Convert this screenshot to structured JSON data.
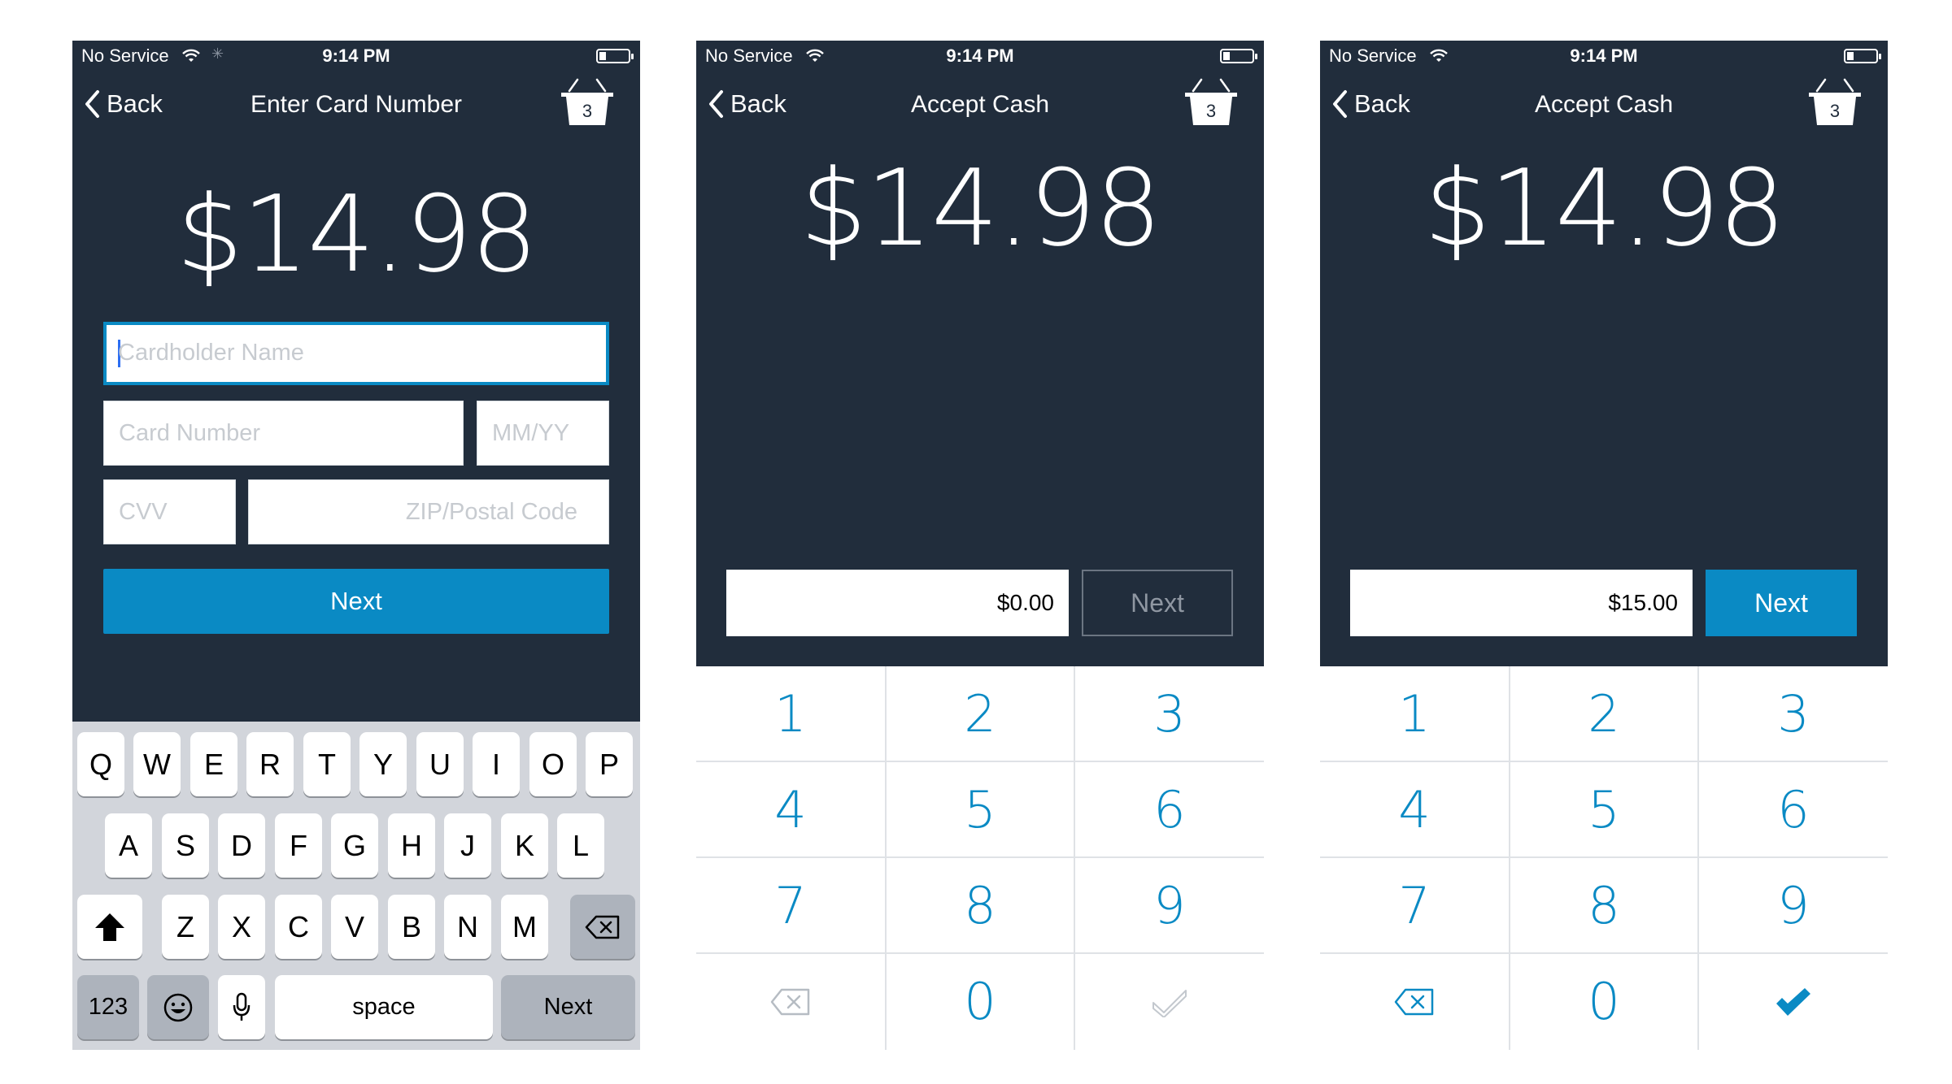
{
  "status": {
    "carrier": "No Service",
    "time": "9:14 PM"
  },
  "screens": {
    "card": {
      "back_label": "Back",
      "title": "Enter Card Number",
      "cart_count": "3",
      "amount": "$14.98",
      "fields": {
        "cardholder": "Cardholder Name",
        "card_number": "Card Number",
        "expiry": "MM/YY",
        "cvv": "CVV",
        "zip": "ZIP/Postal Code"
      },
      "next_label": "Next"
    },
    "cash_empty": {
      "back_label": "Back",
      "title": "Accept Cash",
      "cart_count": "3",
      "amount": "$14.98",
      "input_value": "$0.00",
      "next_label": "Next"
    },
    "cash_filled": {
      "back_label": "Back",
      "title": "Accept Cash",
      "cart_count": "3",
      "amount": "$14.98",
      "input_value": "$15.00",
      "next_label": "Next"
    }
  },
  "keyboard": {
    "row1": [
      "Q",
      "W",
      "E",
      "R",
      "T",
      "Y",
      "U",
      "I",
      "O",
      "P"
    ],
    "row2": [
      "A",
      "S",
      "D",
      "F",
      "G",
      "H",
      "J",
      "K",
      "L"
    ],
    "row3": [
      "Z",
      "X",
      "C",
      "V",
      "B",
      "N",
      "M"
    ],
    "numbers_key": "123",
    "space_key": "space",
    "return_key": "Next"
  },
  "keypad": {
    "digits": [
      "1",
      "2",
      "3",
      "4",
      "5",
      "6",
      "7",
      "8",
      "9",
      "0"
    ],
    "icons": {
      "delete": "delete-icon",
      "confirm": "checkmark-icon"
    }
  },
  "colors": {
    "background_dark": "#212d3c",
    "accent": "#0a8ac4",
    "keyboard_bg": "#d2d5db"
  }
}
